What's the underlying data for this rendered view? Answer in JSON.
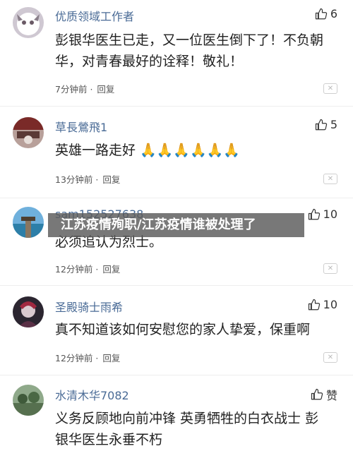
{
  "comments": [
    {
      "username": "优质领域工作者",
      "likes": "6",
      "content": "彭银华医生已走，又一位医生倒下了！不负朝华，对青春最好的诠释！敬礼！",
      "time": "7分钟前",
      "reply": "回复"
    },
    {
      "username": "草長鶯飛1",
      "likes": "5",
      "content": "英雄一路走好 🙏🙏🙏🙏🙏🙏",
      "time": "13分钟前",
      "reply": "回复"
    },
    {
      "username": "sam152527638",
      "likes": "10",
      "content": "必须追认为烈士。",
      "time": "12分钟前",
      "reply": "回复"
    },
    {
      "username": "圣殿骑士雨希",
      "likes": "10",
      "content": "真不知道该如何安慰您的家人挚爱，保重啊",
      "time": "12分钟前",
      "reply": "回复"
    },
    {
      "username": "水清木华7082",
      "likes": "赞",
      "content": "义务反顾地向前冲锋 英勇牺牲的白衣战士 彭银华医生永垂不朽",
      "time": "",
      "reply": ""
    }
  ],
  "separator": "·",
  "close_glyph": "✕",
  "overlay_text": "江苏疫情殉职/江苏疫情谁被处理了",
  "colors": {
    "username": "#4a6b96",
    "overlay_bg": "#5a5a5a"
  },
  "icons": {
    "like": "thumb-up-icon",
    "close": "close-icon"
  }
}
